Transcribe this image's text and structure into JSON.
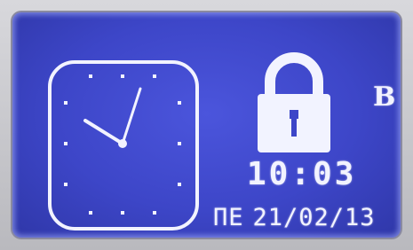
{
  "display": {
    "time": "10:03",
    "day_of_week": "ПЕ",
    "date": "21/02/13",
    "indicator": "B",
    "clock_icon": "analog-clock-icon",
    "lock_icon": "padlock-icon",
    "clock_reading": {
      "hour": 10,
      "minute": 3
    }
  },
  "colors": {
    "screen_background": "#3d46c8",
    "foreground": "#f2f3ff"
  }
}
